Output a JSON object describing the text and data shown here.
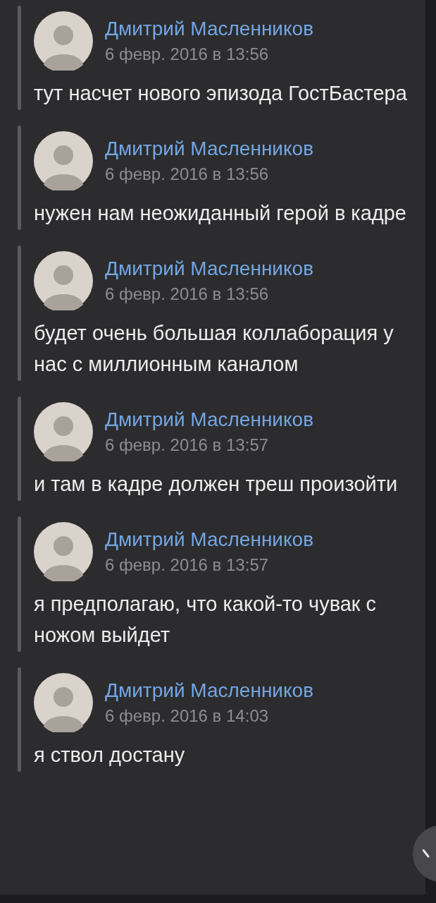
{
  "messages": [
    {
      "author": "Дмитрий Масленников",
      "date": "6 февр. 2016 в 13:56",
      "text": "тут насчет нового эпизода ГостБастера"
    },
    {
      "author": "Дмитрий Масленников",
      "date": "6 февр. 2016 в 13:56",
      "text": "нужен нам неожиданный герой в кадре"
    },
    {
      "author": "Дмитрий Масленников",
      "date": "6 февр. 2016 в 13:56",
      "text": "будет очень большая коллаборация у нас с миллионным каналом"
    },
    {
      "author": "Дмитрий Масленников",
      "date": "6 февр. 2016 в 13:57",
      "text": "и там в кадре должен треш произойти"
    },
    {
      "author": "Дмитрий Масленников",
      "date": "6 февр. 2016 в 13:57",
      "text": "я предполагаю, что какой-то чувак с ножом выйдет"
    },
    {
      "author": "Дмитрий Масленников",
      "date": "6 февр. 2016 в 14:03",
      "text": "я ствол достану"
    }
  ]
}
